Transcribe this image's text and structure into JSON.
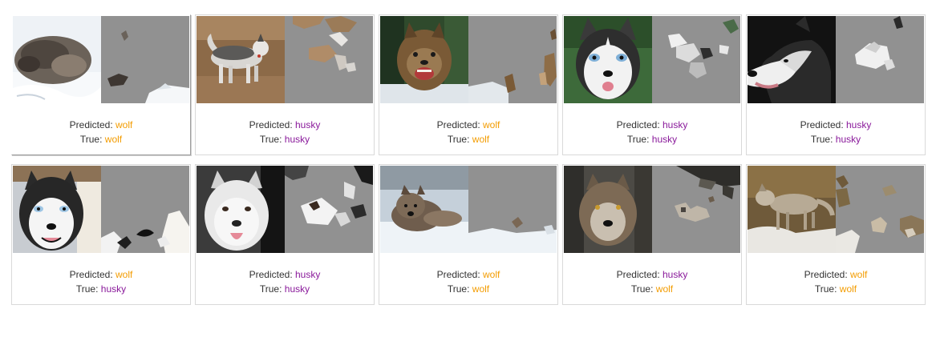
{
  "labels": {
    "predicted_prefix": "Predicted:",
    "true_prefix": "True:"
  },
  "colors": {
    "wolf": "#f39c00",
    "husky": "#8a1a9b",
    "mask_gray": "#919191"
  },
  "rows": [
    {
      "cards": [
        {
          "predicted": "wolf",
          "true": "wolf",
          "scene": "wolf-sleeping-snow",
          "selected": true
        },
        {
          "predicted": "husky",
          "true": "husky",
          "scene": "husky-walking-dirt",
          "selected": false
        },
        {
          "predicted": "wolf",
          "true": "wolf",
          "scene": "wolf-snarling-forest",
          "selected": false
        },
        {
          "predicted": "husky",
          "true": "husky",
          "scene": "husky-closeup-grass",
          "selected": false
        },
        {
          "predicted": "husky",
          "true": "husky",
          "scene": "husky-profile-dark",
          "selected": false
        }
      ]
    },
    {
      "cards": [
        {
          "predicted": "wolf",
          "true": "husky",
          "scene": "husky-face-snow",
          "selected": false
        },
        {
          "predicted": "husky",
          "true": "husky",
          "scene": "white-husky-tongue",
          "selected": false
        },
        {
          "predicted": "wolf",
          "true": "wolf",
          "scene": "wolf-lying-snow",
          "selected": false
        },
        {
          "predicted": "husky",
          "true": "wolf",
          "scene": "wolf-portrait-rocks",
          "selected": false
        },
        {
          "predicted": "wolf",
          "true": "wolf",
          "scene": "wolf-standing-rock",
          "selected": false
        }
      ]
    }
  ]
}
